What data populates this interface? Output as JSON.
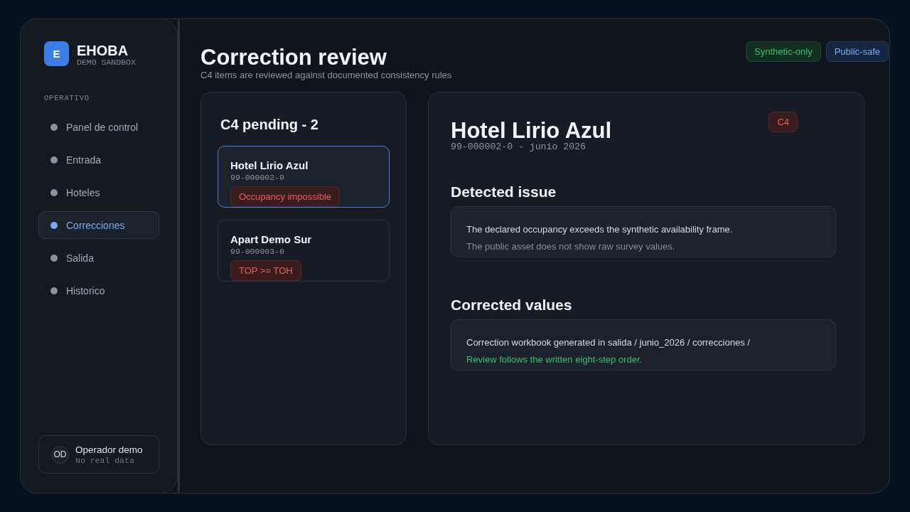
{
  "sidebar": {
    "brand": {
      "logo_letter": "E",
      "name": "EHOBA",
      "subtitle": "DEMO SANDBOX"
    },
    "section_label": "OPERATIVO",
    "items": [
      {
        "label": "Panel de control",
        "selected": false
      },
      {
        "label": "Entrada",
        "selected": false
      },
      {
        "label": "Hoteles",
        "selected": false
      },
      {
        "label": "Correcciones",
        "selected": true
      },
      {
        "label": "Salida",
        "selected": false
      },
      {
        "label": "Historico",
        "selected": false
      }
    ],
    "user": {
      "initials": "OD",
      "name": "Operador demo",
      "note": "No real data"
    }
  },
  "header": {
    "title": "Correction review",
    "subtitle": "C4 items are reviewed against documented consistency rules",
    "badges": [
      {
        "label": "Synthetic-only",
        "kind": "success"
      },
      {
        "label": "Public-safe",
        "kind": "info"
      }
    ]
  },
  "pending": {
    "title": "C4 pending - 2",
    "items": [
      {
        "name": "Hotel Lirio Azul",
        "code": "99-000002-0",
        "issue": "Occupancy impossible",
        "selected": true
      },
      {
        "name": "Apart Demo Sur",
        "code": "99-000003-0",
        "issue": "TOP >= TOH",
        "selected": false
      }
    ]
  },
  "detail": {
    "title": "Hotel Lirio Azul",
    "meta": "99-000002-0 - junio 2026",
    "badge": "C4",
    "sections": [
      {
        "heading": "Detected issue",
        "lines": [
          {
            "text": "The declared occupancy exceeds the synthetic availability frame.",
            "kind": "primary"
          },
          {
            "text": "The public asset does not show raw survey values.",
            "kind": "muted"
          }
        ]
      },
      {
        "heading": "Corrected values",
        "lines": [
          {
            "text": "Correction workbook generated in salida / junio_2026 / correcciones /",
            "kind": "primary"
          },
          {
            "text": "Review follows the written eight-step order.",
            "kind": "success"
          }
        ]
      }
    ]
  }
}
